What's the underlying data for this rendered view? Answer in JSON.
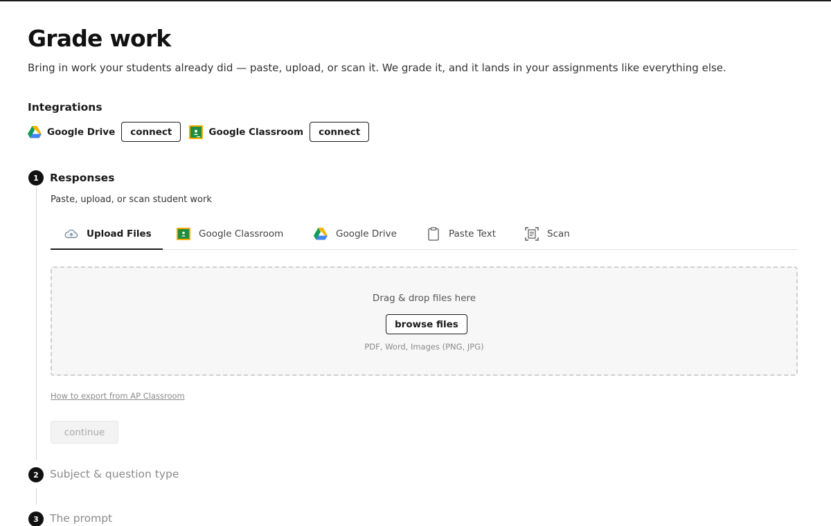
{
  "page": {
    "title": "Grade work",
    "subtitle": "Bring in work your students already did — paste, upload, or scan it. We grade it, and it lands in your assignments like everything else."
  },
  "integrations": {
    "label": "Integrations",
    "items": [
      {
        "name": "Google Drive",
        "icon": "google-drive-icon",
        "button": "connect"
      },
      {
        "name": "Google Classroom",
        "icon": "google-classroom-icon",
        "button": "connect"
      }
    ]
  },
  "steps": [
    {
      "number": "1",
      "title": "Responses",
      "state": "active"
    },
    {
      "number": "2",
      "title": "Subject & question type",
      "state": "inactive"
    },
    {
      "number": "3",
      "title": "The prompt",
      "state": "inactive"
    }
  ],
  "responses": {
    "description": "Paste, upload, or scan student work",
    "tabs": [
      {
        "label": "Upload Files",
        "icon": "cloud-upload-icon",
        "active": true
      },
      {
        "label": "Google Classroom",
        "icon": "google-classroom-icon",
        "active": false
      },
      {
        "label": "Google Drive",
        "icon": "google-drive-icon",
        "active": false
      },
      {
        "label": "Paste Text",
        "icon": "clipboard-icon",
        "active": false
      },
      {
        "label": "Scan",
        "icon": "scan-icon",
        "active": false
      }
    ],
    "dropzone": {
      "text": "Drag & drop files here",
      "button": "browse files",
      "formats": "PDF, Word, Images (PNG, JPG)"
    },
    "help_link": "How to export from AP Classroom",
    "continue_label": "continue"
  },
  "colors": {
    "text": "#1a1a1a",
    "muted": "#8a8a8a",
    "classroom_green": "#1e8e3e",
    "classroom_yellow": "#f9ab00",
    "drive_blue": "#4285f4",
    "drive_green": "#0f9d58",
    "drive_yellow": "#f4b400"
  }
}
